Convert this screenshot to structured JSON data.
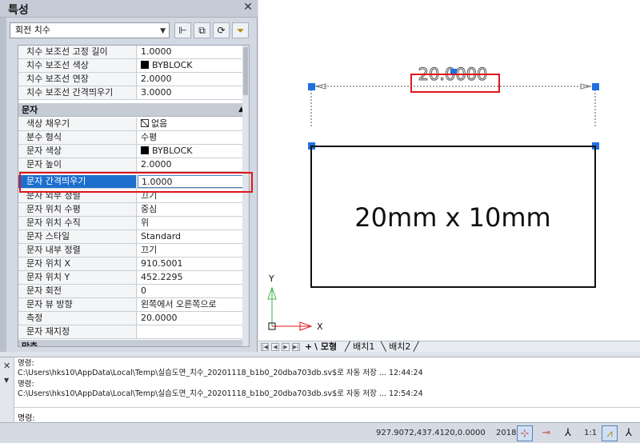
{
  "palette": {
    "title": "특성",
    "object_type": "회전 치수",
    "rows_top": [
      {
        "label": "치수 보조선 고정 길이",
        "value": "1.0000"
      },
      {
        "label": "치수 보조선 색상",
        "value": "BYBLOCK"
      },
      {
        "label": "치수 보조선 연장",
        "value": "2.0000"
      },
      {
        "label": "치수 보조선 간격띄우기",
        "value": "3.0000"
      }
    ],
    "category_text": "문자",
    "rows_text": [
      {
        "label": "색상 채우기",
        "value": "없음"
      },
      {
        "label": "분수 형식",
        "value": "수평"
      },
      {
        "label": "문자 색상",
        "value": "BYBLOCK"
      },
      {
        "label": "문자 높이",
        "value": "2.0000"
      },
      {
        "label": "문자 간격띄우기",
        "value": "1.0000"
      },
      {
        "label": "문자 외부 정렬",
        "value": "끄기"
      },
      {
        "label": "문자 위치 수평",
        "value": "중심"
      },
      {
        "label": "문자 위치 수직",
        "value": "위"
      },
      {
        "label": "문자 스타일",
        "value": "Standard"
      },
      {
        "label": "문자 내부 정렬",
        "value": "끄기"
      },
      {
        "label": "문자 위치 X",
        "value": "910.5001"
      },
      {
        "label": "문자 위치 Y",
        "value": "452.2295"
      },
      {
        "label": "문자 회전",
        "value": "0"
      },
      {
        "label": "문자 뷰 방향",
        "value": "왼쪽에서 오른쪽으로"
      },
      {
        "label": "측정",
        "value": "20.0000"
      },
      {
        "label": "문자 재지정",
        "value": ""
      }
    ],
    "category_next": "맞춤"
  },
  "drawing": {
    "dimension_text": "20.0000",
    "rect_label": "20mm x 10mm",
    "ucs_y": "Y",
    "ucs_x": "X"
  },
  "layout_tabs": [
    "모형",
    "배치1",
    "배치2"
  ],
  "command": {
    "lines": [
      "명령:",
      "C:\\Users\\hks10\\AppData\\Local\\Temp\\실습도면_치수_20201118_b1b0_20dba703db.sv$로 자동 저장 ... 12:44:24",
      "명령:",
      "C:\\Users\\hks10\\AppData\\Local\\Temp\\실습도면_치수_20201118_b1b0_20dba703db.sv$로 자동 저장 ... 12:54:24"
    ],
    "prompt": "명령:"
  },
  "status": {
    "coords": "927.9072,437.4120,0.0000",
    "version": "2018",
    "scale": "1:1"
  },
  "colors": {
    "selection": "#1d6fce",
    "highlight": "#e0151b",
    "grip": "#1f6fe0"
  }
}
